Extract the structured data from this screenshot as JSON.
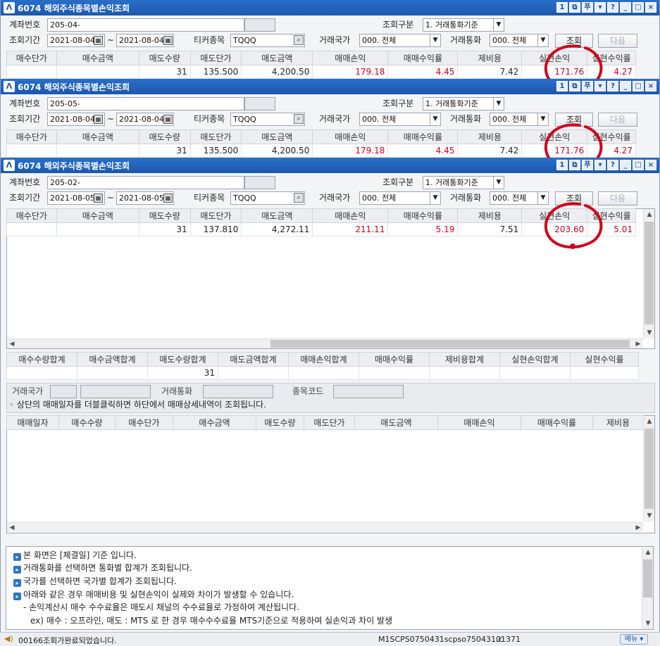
{
  "windows": [
    {
      "title": "6074 해외주식종목별손익조회",
      "account_label": "계좌번호",
      "account": "205-04-",
      "inquiry_type_label": "조회구분",
      "inquiry_type": "1. 거래통화기준",
      "period_label": "조회기간",
      "date_from": "2021-08-04",
      "tilde": "~",
      "date_to": "2021-08-04",
      "ticker_label": "티커종목",
      "ticker": "TQQQ",
      "country_label": "거래국가",
      "country": "000. 전체",
      "currency_label": "거래통화",
      "currency": "000. 전체",
      "search_btn": "조회",
      "next_btn": "다음",
      "row": [
        "",
        "",
        "31",
        "135.500",
        "4,200.50",
        "179.18",
        "4.45",
        "7.42",
        "171.76",
        "4.27"
      ]
    },
    {
      "title": "6074 해외주식종목별손익조회",
      "account_label": "계좌번호",
      "account": "205-05-",
      "inquiry_type_label": "조회구분",
      "inquiry_type": "1. 거래통화기준",
      "period_label": "조회기간",
      "date_from": "2021-08-04",
      "tilde": "~",
      "date_to": "2021-08-04",
      "ticker_label": "티커종목",
      "ticker": "TQQQ",
      "country_label": "거래국가",
      "country": "000. 전체",
      "currency_label": "거래통화",
      "currency": "000. 전체",
      "search_btn": "조회",
      "next_btn": "다음",
      "row": [
        "",
        "",
        "31",
        "135.500",
        "4,200.50",
        "179.18",
        "4.45",
        "7.42",
        "171.76",
        "4.27"
      ]
    },
    {
      "title": "6074 해외주식종목별손익조회",
      "account_label": "계좌번호",
      "account": "205-02-",
      "inquiry_type_label": "조회구분",
      "inquiry_type": "1. 거래통화기준",
      "period_label": "조회기간",
      "date_from": "2021-08-05",
      "tilde": "~",
      "date_to": "2021-08-05",
      "ticker_label": "티커종목",
      "ticker": "TQQQ",
      "country_label": "거래국가",
      "country": "000. 전체",
      "currency_label": "거래통화",
      "currency": "000. 전체",
      "search_btn": "조회",
      "next_btn": "다음",
      "row": [
        "",
        "",
        "31",
        "137.810",
        "4,272.11",
        "211.11",
        "5.19",
        "7.51",
        "203.60",
        "5.01"
      ]
    }
  ],
  "title_buttons": [
    "1",
    "⧉",
    "푸",
    "▾",
    "?",
    "_",
    "□",
    "×"
  ],
  "grid_headers": [
    "매수단가",
    "매수금액",
    "매도수량",
    "매도단가",
    "매도금액",
    "매매손익",
    "매매수익률",
    "제비용",
    "실현손익",
    "실현수익률"
  ],
  "summary": {
    "headers": [
      "매수수량합계",
      "매수금액합계",
      "매도수량합계",
      "매도금액합계",
      "매매손익합계",
      "매매수익률",
      "제비용합계",
      "실현손익합계",
      "실현수익률"
    ],
    "values": [
      "",
      "",
      "31",
      "",
      "",
      "",
      "",
      "",
      ""
    ]
  },
  "detail_filter": {
    "country_label": "거래국가",
    "currency_label": "거래통화",
    "code_label": "종목코드",
    "hint": "◦ 상단의 매매일자를 더블클릭하면 하단에서 매매상세내역이 조회됩니다."
  },
  "detail_headers": [
    "매매일자",
    "매수수량",
    "매수단가",
    "매수금액",
    "매도수량",
    "매도단가",
    "매도금액",
    "매매손익",
    "매매수익률",
    "제비용"
  ],
  "notes": [
    "본 화면은 [체결일] 기준 입니다.",
    "거래통화를 선택하면 통화별 합계가 조회됩니다.",
    "국가를 선택하면 국가별 합계가 조회됩니다.",
    "아래와 같은 경우 매매비용 및 실현손익이 실제와 차이가 발생할 수 있습니다.",
    "- 손익계산시 매수 수수료율은 매도시 채널의 수수료율로 가정하여 계산됩니다.",
    "ex) 매수 : 오프라인,  매도 : MTS 로 한 경우  매수수수료율 MTS기준으로 적용하여 실손익과 차이 발생"
  ],
  "status": {
    "message": "00166조회가완료되었습니다.",
    "program": "M1SCPS0750431scpso750431.c",
    "code": "01371",
    "menu": "메뉴"
  },
  "colors": {
    "titlebar": "#1b58ad",
    "profit_red": "#d0021b",
    "highlight_circle": "#d0021b"
  }
}
